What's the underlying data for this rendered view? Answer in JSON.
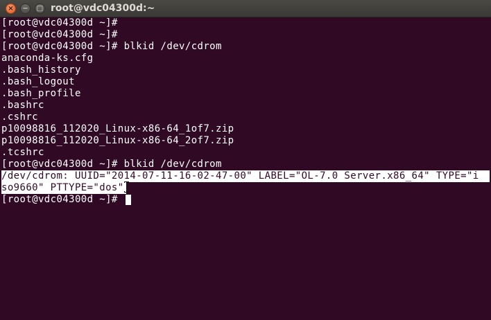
{
  "window": {
    "title": "root@vdc04300d:~",
    "close_glyph": "×",
    "minimize_glyph": "−",
    "maximize_glyph": "□"
  },
  "colors": {
    "terminal_background": "#300a24",
    "text": "#ffffff",
    "close_button": "#e2561e"
  },
  "terminal": {
    "lines": [
      "[root@vdc04300d ~]#",
      "[root@vdc04300d ~]#",
      "[root@vdc04300d ~]# blkid /dev/cdrom",
      "anaconda-ks.cfg",
      ".bash_history",
      ".bash_logout",
      ".bash_profile",
      ".bashrc",
      ".cshrc",
      "p10098816_112020_Linux-x86-64_1of7.zip",
      "p10098816_112020_Linux-x86-64_2of7.zip",
      ".tcshrc",
      "[root@vdc04300d ~]# blkid /dev/cdrom"
    ],
    "selected_output": [
      "/dev/cdrom: UUID=\"2014-07-11-16-02-47-00\" LABEL=\"OL-7.0 Server.x86_64\" TYPE=\"i",
      "so9660\" PTTYPE=\"dos\""
    ],
    "prompt": "[root@vdc04300d ~]# "
  }
}
